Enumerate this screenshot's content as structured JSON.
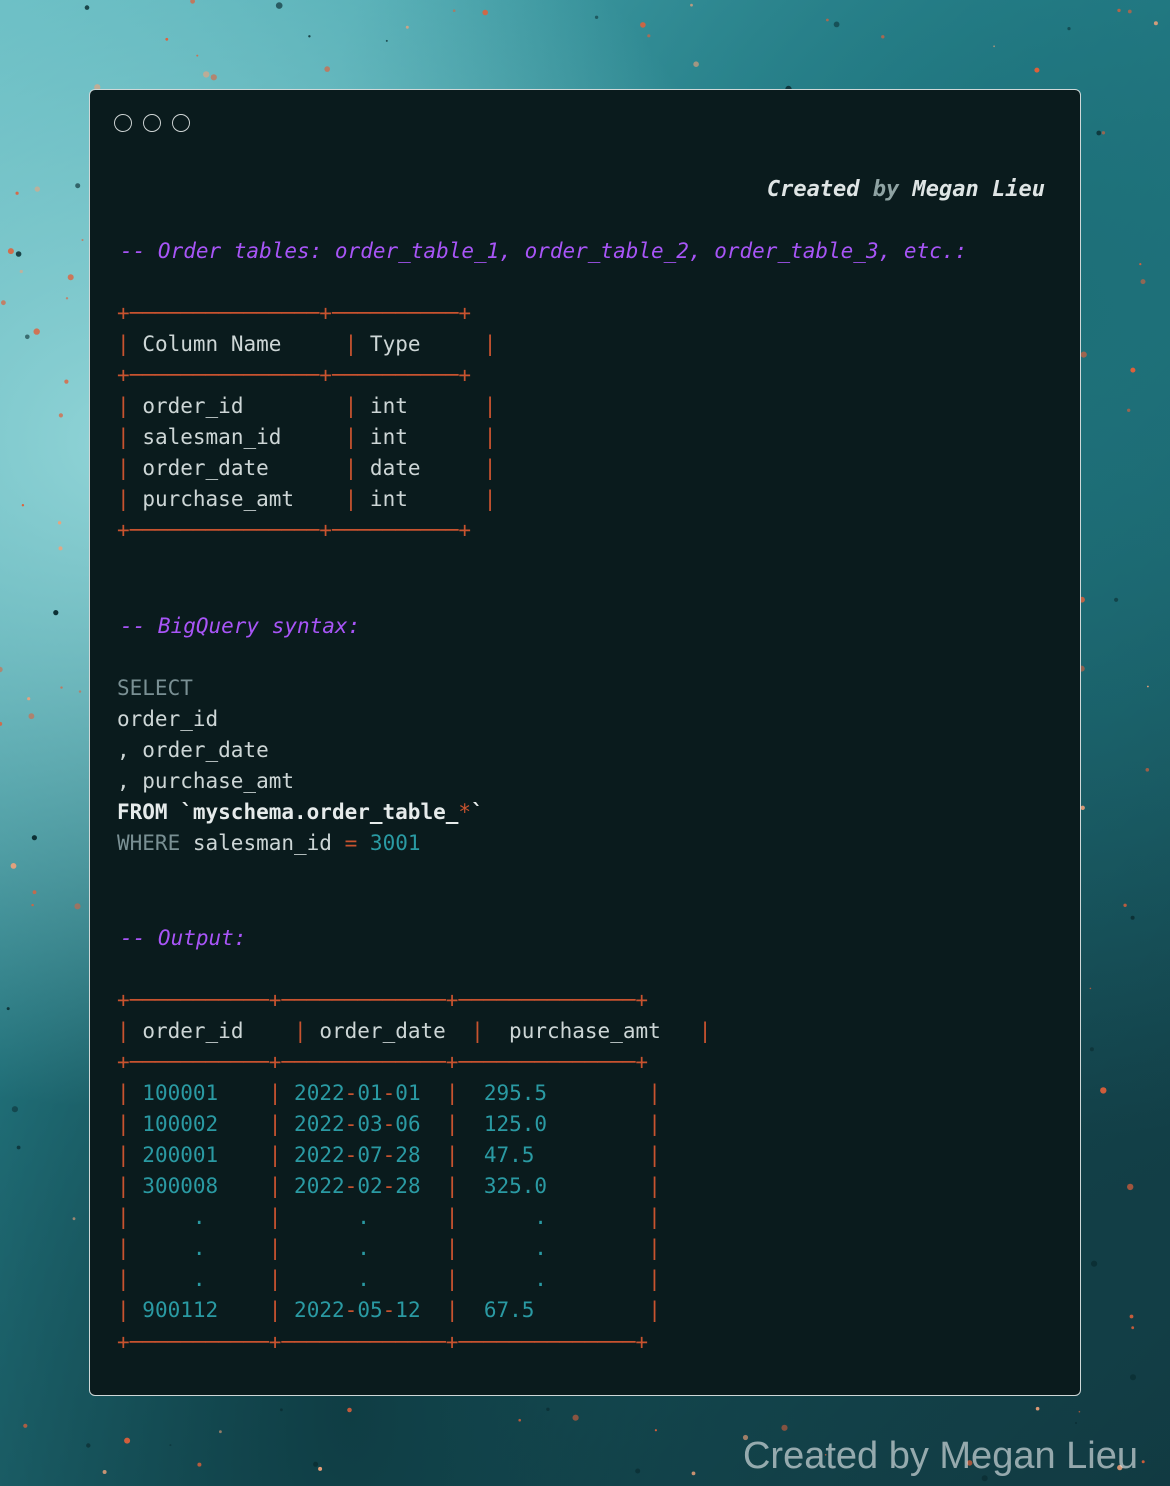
{
  "window": {
    "credit": {
      "created": "Created",
      "by": "by",
      "name": "Megan Lieu"
    },
    "comment_tables": "-- Order tables: order_table_1, order_table_2, order_table_3, etc.:",
    "schema_table": {
      "border_top": "+──────────────────+──────────+",
      "header": [
        "Column Name",
        "Type"
      ],
      "rows": [
        [
          "order_id",
          "int"
        ],
        [
          "salesman_id",
          "int"
        ],
        [
          "order_date",
          "date"
        ],
        [
          "purchase_amt",
          "int"
        ]
      ]
    },
    "comment_syntax": "-- BigQuery syntax:",
    "query": {
      "select": "SELECT",
      "col1": "order_id",
      "col2": ", order_date",
      "col3": ", purchase_amt",
      "from_kw": "FROM",
      "table": "`myschema.order_table_",
      "wildcard": "*",
      "table_end": "`",
      "where_kw": "WHERE",
      "where_col": "salesman_id",
      "where_op": "=",
      "where_val": "3001"
    },
    "comment_output": "-- Output:",
    "output_table": {
      "header": [
        "order_id",
        "order_date",
        "purchase_amt"
      ],
      "rows": [
        [
          "100001",
          "2022-01-01",
          "295.5"
        ],
        [
          "100002",
          "2022-03-06",
          "125.0"
        ],
        [
          "200001",
          "2022-07-28",
          "47.5"
        ],
        [
          "300008",
          "2022-02-28",
          "325.0"
        ],
        [
          ".",
          ".",
          "."
        ],
        [
          ".",
          ".",
          "."
        ],
        [
          ".",
          ".",
          "."
        ],
        [
          "900112",
          "2022-05-12",
          "67.5"
        ]
      ]
    }
  },
  "watermark": "Created by Megan Lieu",
  "colors": {
    "comment": "#a855f7",
    "border": "#c8532f",
    "number": "#2a9aa3",
    "window_bg": "#0a1b1d"
  }
}
